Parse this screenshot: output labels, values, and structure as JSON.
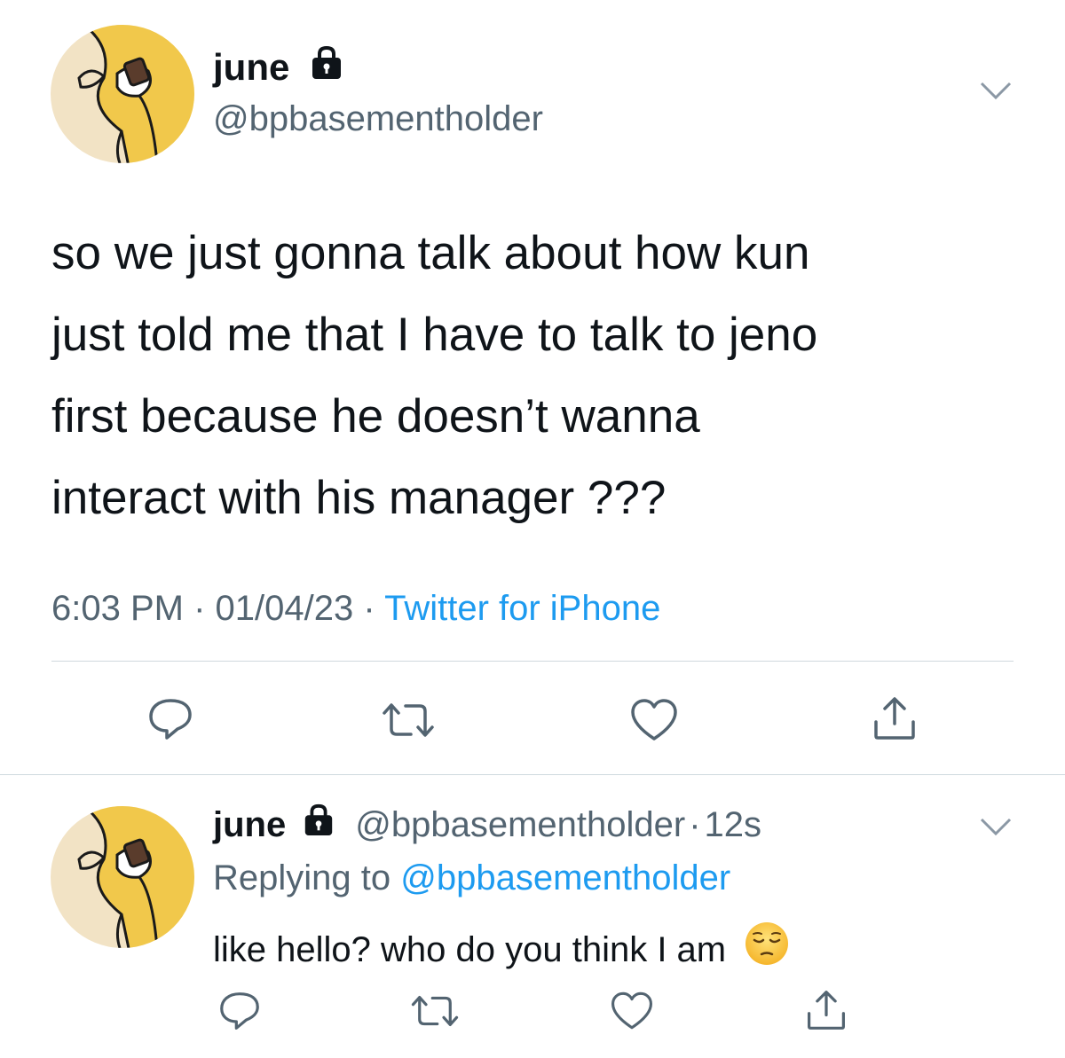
{
  "tweet": {
    "author": {
      "display_name": "june",
      "handle": "@bpbasementholder",
      "avatar_icon": "cartoon-avatar-icon",
      "lock_icon": "lock-icon"
    },
    "text": "so we just gonna talk about how kun\njust told me that I have to talk to jeno\nfirst because he doesn’t wanna\ninteract with his manager ???",
    "time": "6:03 PM",
    "date": "01/04/23",
    "separator": "·",
    "source": "Twitter for iPhone",
    "actions": [
      "reply-icon",
      "retweet-icon",
      "like-icon",
      "share-icon"
    ]
  },
  "reply": {
    "author": {
      "display_name": "june",
      "handle": "@bpbasementholder",
      "age": "12s"
    },
    "replying_prefix": "Replying to",
    "replying_to": "@bpbasementholder",
    "text": "like hello? who do you think I am",
    "emoji": "pensive-face-icon",
    "actions": [
      "reply-icon",
      "retweet-icon",
      "like-icon",
      "share-icon"
    ]
  },
  "colors": {
    "text": "#0f1419",
    "secondary": "#536471",
    "link": "#1d9bf0",
    "divider": "#cfd9de",
    "avatar_bg": "#f2e3c5",
    "avatar_accent": "#f1c84b"
  }
}
